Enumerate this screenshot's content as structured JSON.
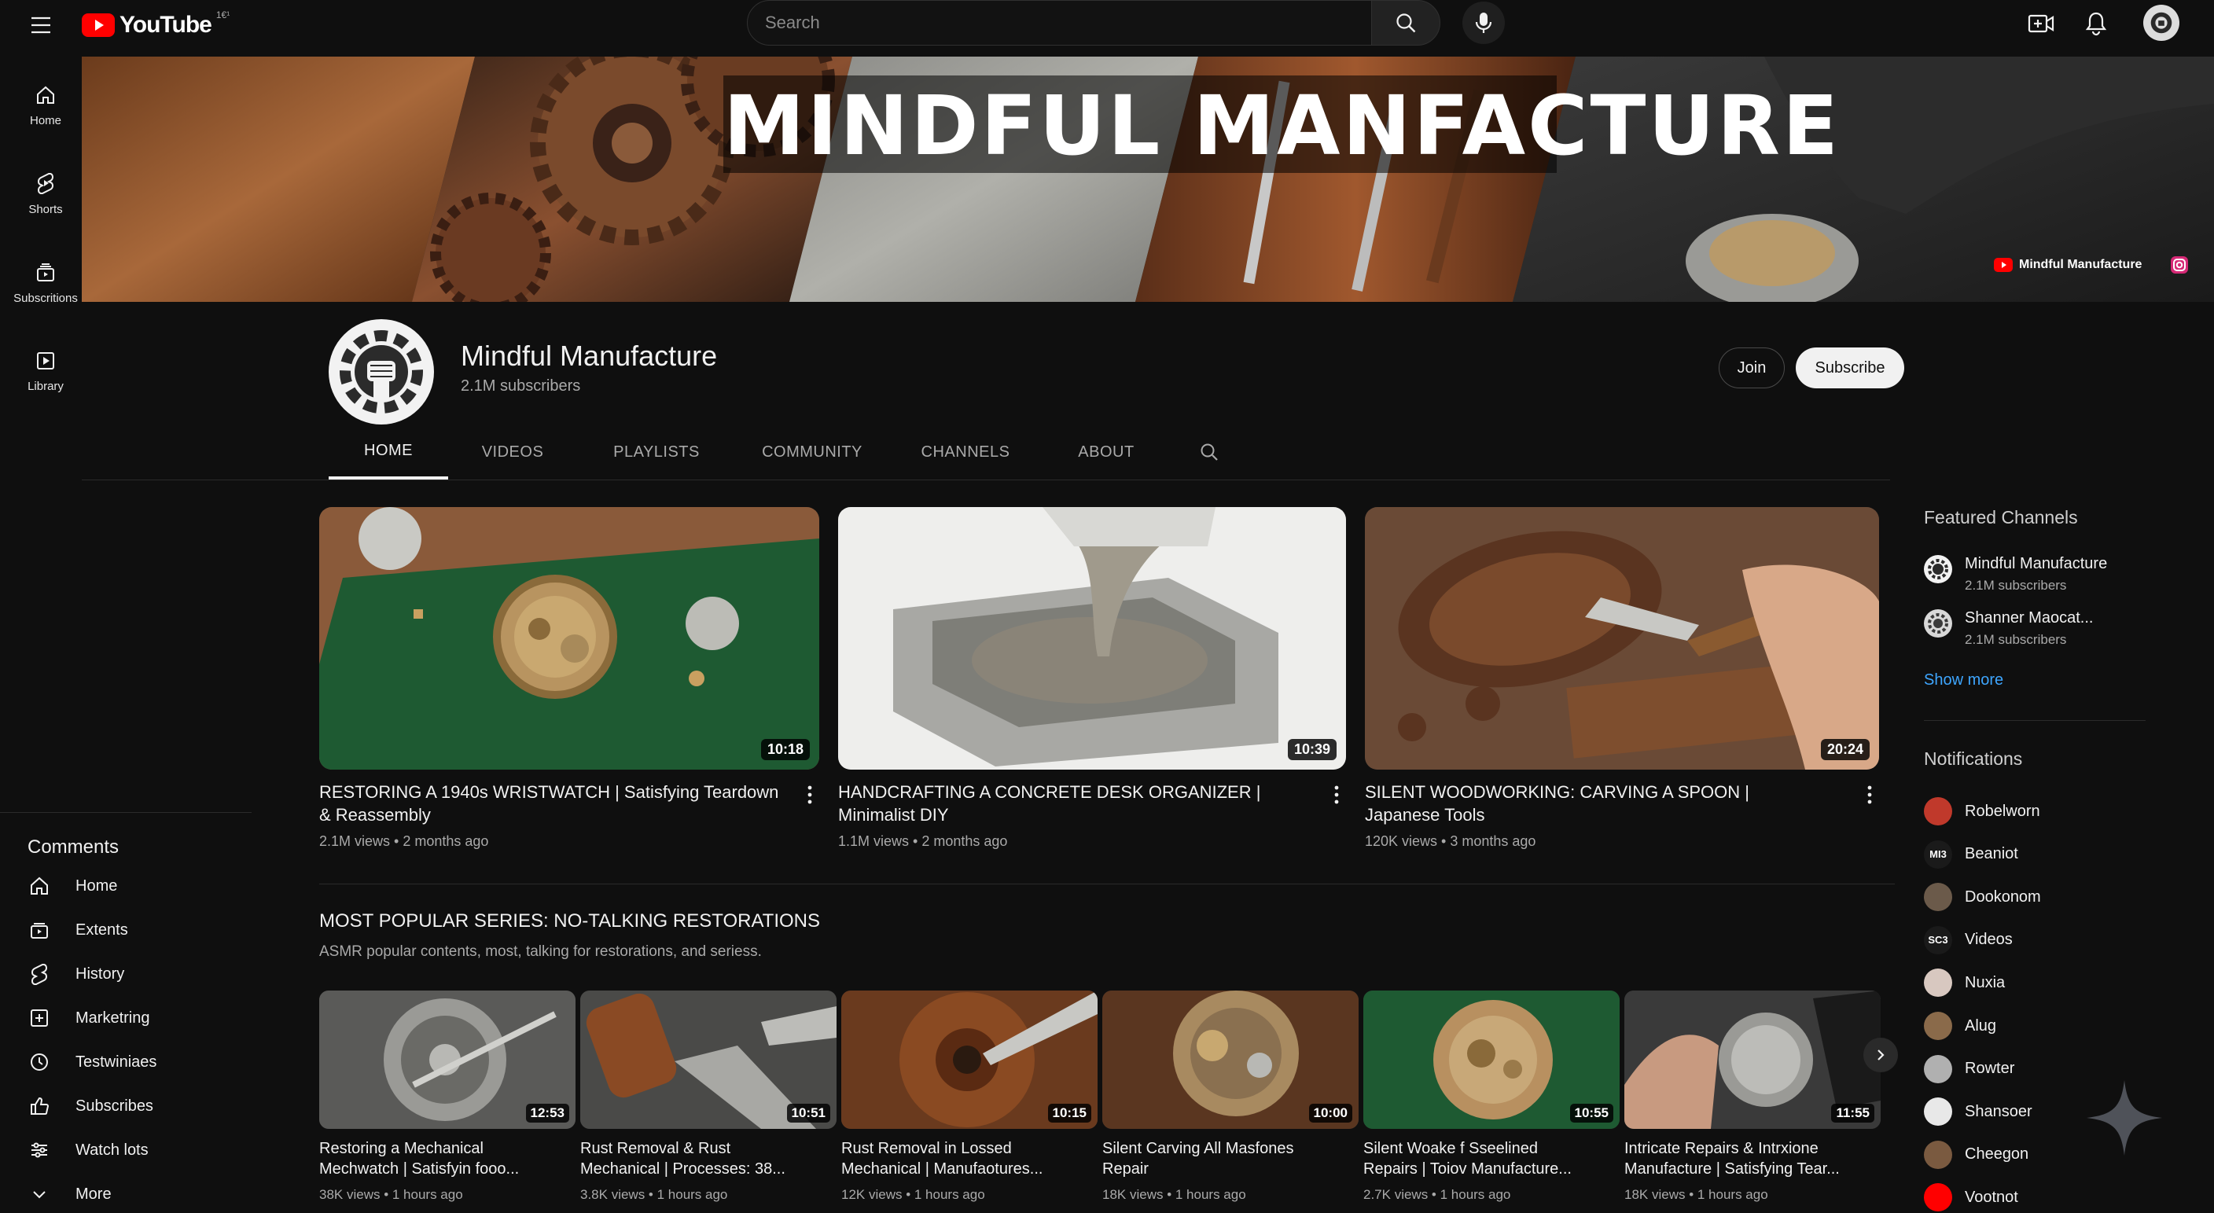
{
  "topbar": {
    "logo_text": "YouTube",
    "logo_superscript": "1€¹",
    "search_placeholder": "Search"
  },
  "left_rail": [
    {
      "label": "Home",
      "icon": "home-icon"
    },
    {
      "label": "Shorts",
      "icon": "shorts-icon"
    },
    {
      "label": "Subscritions",
      "icon": "subscriptions-icon"
    },
    {
      "label": "Library",
      "icon": "library-icon"
    }
  ],
  "banner": {
    "title": "MINDFUL MANFACTURE",
    "link_text": "Mindful Manufacture"
  },
  "channel": {
    "name": "Mindful Manufacture",
    "subscribers": "2.1M subscribers",
    "join_label": "Join",
    "subscribe_label": "Subscribe"
  },
  "tabs": [
    {
      "label": "HOME",
      "active": true
    },
    {
      "label": "VIDEOS",
      "active": false
    },
    {
      "label": "PLAYLISTS",
      "active": false
    },
    {
      "label": "COMMUNITY",
      "active": false
    },
    {
      "label": "CHANNELS",
      "active": false
    },
    {
      "label": "ABOUT",
      "active": false
    }
  ],
  "featured_videos": [
    {
      "title": "RESTORING A 1940s WRISTWATCH | Satisfying Teardown & Reassembly",
      "duration": "10:18",
      "meta": "2.1M views • 2 months ago"
    },
    {
      "title": "HANDCRAFTING A CONCRETE DESK ORGANIZER | Minimalist DIY",
      "duration": "10:39",
      "meta": "1.1M views • 2 months ago"
    },
    {
      "title": "SILENT WOODWORKING: CARVING A SPOON | Japanese Tools",
      "duration": "20:24",
      "meta": "120K views • 3 months ago"
    }
  ],
  "series": {
    "title": "MOST POPULAR SERIES: NO-TALKING RESTORATIONS",
    "description": "ASMR popular contents, most, talking for restorations, and seriess.",
    "videos": [
      {
        "title_line1": "Restoring a Mechanical",
        "title_line2": "Mechwatch | Satisfyin fooo...",
        "duration": "12:53",
        "meta": "38K views • 1 hours ago"
      },
      {
        "title_line1": "Rust Removal & Rust",
        "title_line2": "Mechanical | Processes: 38...",
        "duration": "10:51",
        "meta": "3.8K views • 1 hours ago"
      },
      {
        "title_line1": "Rust Removal in Lossed",
        "title_line2": "Mechanical | Manufaotures...",
        "duration": "10:15",
        "meta": "12K views • 1 hours ago"
      },
      {
        "title_line1": "Silent Carving All Masfones",
        "title_line2": "Repair",
        "duration": "10:00",
        "meta": "18K views • 1 hours ago"
      },
      {
        "title_line1": "Silent Woake f Sseelined",
        "title_line2": "Repairs | Toiov Manufacture...",
        "duration": "10:55",
        "meta": "2.7K views • 1 hours ago"
      },
      {
        "title_line1": "Intricate Repairs & Intrxione",
        "title_line2": "Manufacture | Satisfying Tear...",
        "duration": "11:55",
        "meta": "18K views • 1 hours ago"
      }
    ]
  },
  "comments_panel": {
    "heading": "Comments",
    "items": [
      {
        "label": "Home",
        "icon": "home-icon"
      },
      {
        "label": "Extents",
        "icon": "subscriptions-icon"
      },
      {
        "label": "History",
        "icon": "shorts-icon"
      },
      {
        "label": "Marketring",
        "icon": "add-box-icon"
      },
      {
        "label": "Testwiniaes",
        "icon": "clock-icon"
      },
      {
        "label": "Subscribes",
        "icon": "thumbs-up-icon"
      },
      {
        "label": "Watch lots",
        "icon": "sliders-icon"
      },
      {
        "label": "More",
        "icon": "chevron-down-icon"
      }
    ]
  },
  "featured_channels": {
    "heading": "Featured Channels",
    "items": [
      {
        "name": "Mindful Manufacture",
        "subs": "2.1M subscribers"
      },
      {
        "name": "Shanner Maocat...",
        "subs": "2.1M subscribers"
      }
    ],
    "show_more": "Show more"
  },
  "notifications": {
    "heading": "Notifications",
    "items": [
      {
        "name": "Robelworn",
        "badge": "",
        "color": "#c0392b"
      },
      {
        "name": "Beaniot",
        "badge": "MI3",
        "color": "#1a1a1a"
      },
      {
        "name": "Dookonom",
        "badge": "",
        "color": "#6b5a4a"
      },
      {
        "name": "Videos",
        "badge": "SC3",
        "color": "#1a1a1a"
      },
      {
        "name": "Nuxia",
        "badge": "",
        "color": "#d8c8c0"
      },
      {
        "name": "Alug",
        "badge": "",
        "color": "#8a6a4a"
      },
      {
        "name": "Rowter",
        "badge": "",
        "color": "#b0b0b0"
      },
      {
        "name": "Shansoer",
        "badge": "",
        "color": "#e8e8e8"
      },
      {
        "name": "Cheegon",
        "badge": "",
        "color": "#7a5a40"
      },
      {
        "name": "Vootnot",
        "badge": "",
        "color": "#ff0000"
      }
    ]
  },
  "colors": {
    "accent": "#ff0000",
    "link": "#3ea6ff",
    "background": "#0f0f0f"
  }
}
